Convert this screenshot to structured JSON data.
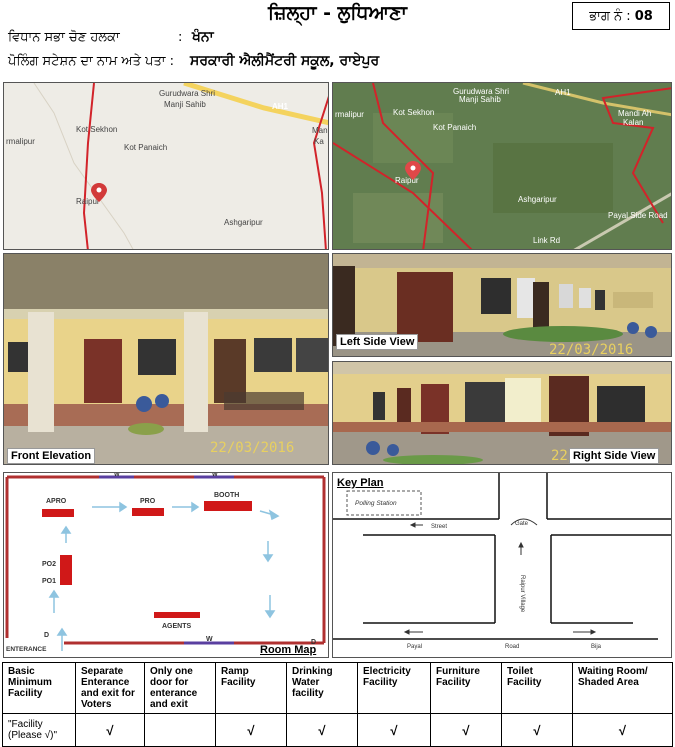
{
  "header": {
    "district_label": "ਜ਼ਿਲ੍ਹਾ - ਲੁਧਿਆਣਾ",
    "part_label": "ਭਾਗ ਨੰ :",
    "part_number": "08"
  },
  "meta": {
    "constituency_label": "ਵਿਧਾਨ ਸਭਾ ਚੋਣ ਹਲਕਾ",
    "constituency_value": "ਖੰਨਾ",
    "station_label": "ਪੋਲਿੰਗ ਸਟੇਸ਼ਨ ਦਾ ਨਾਮ ਅਤੇ ਪਤਾ :",
    "station_value": "ਸਰਕਾਰੀ ਐਲੀਮੈਂਟਰੀ ਸਕੂਲ, ਰਾਏਪੁਰ",
    "colon": ":"
  },
  "road_map": {
    "places": [
      "Gurudwara Shri",
      "Manji Sahib",
      "Kot Sekhon",
      "Kot Panaich",
      "Raipur",
      "Ashgaripur",
      "rmalipur",
      "AH1",
      "Man",
      "Ka"
    ]
  },
  "satellite_map": {
    "places": [
      "Gurudwara Shri",
      "Manji Sahib",
      "Kot Sekhon",
      "Kot Panaich",
      "Raipur",
      "Ashgaripur",
      "Mandi Ah",
      "Kalan",
      "rmalipur",
      "AH1",
      "Link Rd",
      "Payal Side Road"
    ]
  },
  "photos": {
    "front_caption": "Front Elevation",
    "left_caption": "Left Side View",
    "right_caption": "Right Side View",
    "date": "22/03/2016"
  },
  "room_map": {
    "title": "Room Map",
    "labels": {
      "apro": "APRO",
      "pro": "PRO",
      "booth": "BOOTH",
      "po2": "PO2",
      "po1": "PO1",
      "agents": "AGENTS",
      "entrance": "ENTERANCE",
      "d1": "D",
      "d2": "D",
      "w1": "W",
      "w2": "W",
      "w3": "W"
    }
  },
  "key_plan": {
    "title": "Key Plan",
    "polling_station": "Polling Station",
    "street": "Street",
    "gate": "Gate",
    "village": "Raipur Village",
    "payal": "Payal",
    "road": "Road",
    "bija": "Bija"
  },
  "facilities": {
    "headers": [
      "Basic Minimum Facility",
      "Separate Enterance and exit for Voters",
      "Only one door for enterance and exit",
      "Ramp Facility",
      "Drinking Water facility",
      "Electricity Facility",
      "Furniture Facility",
      "Toilet Facility",
      "Waiting Room/ Shaded Area"
    ],
    "row_label": "\"Facility (Please √)\"",
    "ticks": [
      "√",
      "",
      "√",
      "√",
      "√",
      "√",
      "√",
      "√"
    ]
  },
  "colors": {
    "boundary": "#d2232a",
    "room_wall": "#b03030",
    "room_furniture": "#d01818",
    "arrow": "#8ec4e0",
    "window": "#5a3fa0"
  }
}
